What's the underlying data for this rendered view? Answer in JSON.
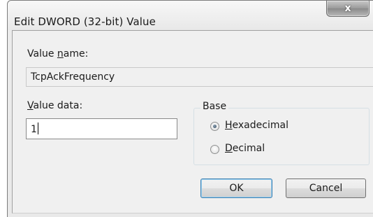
{
  "window": {
    "title": "Edit DWORD (32-bit) Value",
    "close_label": "x"
  },
  "value_name": {
    "label": "Value name:",
    "value": "TcpAckFrequency"
  },
  "value_data": {
    "label": "Value data:",
    "value": "1"
  },
  "base": {
    "legend": "Base",
    "options": [
      {
        "label": "Hexadecimal",
        "checked": true
      },
      {
        "label": "Decimal",
        "checked": false
      }
    ]
  },
  "buttons": {
    "ok": "OK",
    "cancel": "Cancel"
  }
}
